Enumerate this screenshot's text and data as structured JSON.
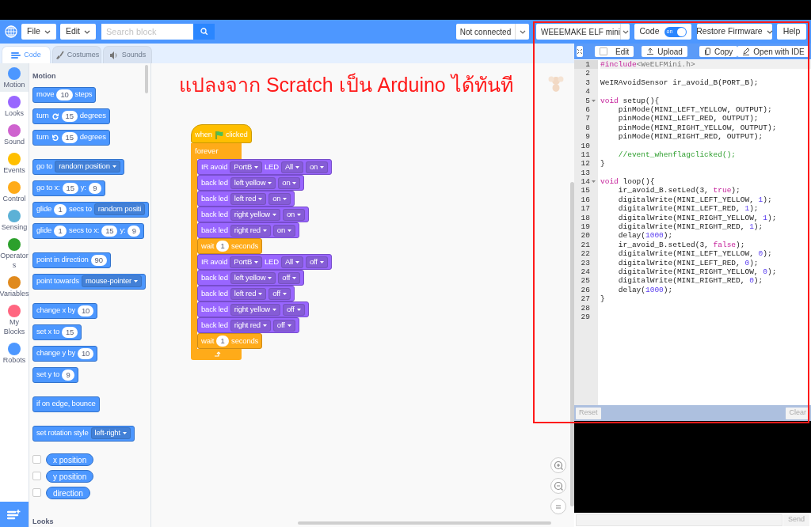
{
  "menu_bar": {
    "file": "File",
    "edit": "Edit",
    "search": {
      "placeholder": "Search block"
    },
    "connection": "Not connected",
    "device": "WEEEMAKE ELF mini",
    "code_toggle": {
      "label": "Code",
      "state_text": "on",
      "on": true
    },
    "restore": "Restore Firmware",
    "help": "Help"
  },
  "tabs": [
    {
      "label": "Code",
      "selected": true
    },
    {
      "label": "Costumes",
      "selected": false
    },
    {
      "label": "Sounds",
      "selected": false
    }
  ],
  "categories": [
    {
      "label": "Motion",
      "color": "#4c97ff",
      "selected": true
    },
    {
      "label": "Looks",
      "color": "#9966ff",
      "selected": false
    },
    {
      "label": "Sound",
      "color": "#cf63cf",
      "selected": false
    },
    {
      "label": "Events",
      "color": "#ffbf00",
      "selected": false
    },
    {
      "label": "Control",
      "color": "#ffab19",
      "selected": false
    },
    {
      "label": "Sensing",
      "color": "#5cb1d6",
      "selected": false
    },
    {
      "label": "Operators",
      "color": "#2ca02c",
      "selected": false
    },
    {
      "label": "Variables",
      "color": "#e08a1e",
      "selected": false
    },
    {
      "label": "My Blocks",
      "color": "#ff6680",
      "selected": false
    },
    {
      "label": "Robots",
      "color": "#4c97ff",
      "selected": false
    }
  ],
  "palette": {
    "heading": "Motion",
    "groups": [
      [
        {
          "kind": "motion",
          "parts": [
            {
              "kind": "text",
              "text": "move"
            },
            {
              "kind": "number",
              "text": "10"
            },
            {
              "kind": "text",
              "text": "steps"
            }
          ]
        },
        {
          "kind": "motion",
          "parts": [
            {
              "kind": "text",
              "text": "turn"
            },
            {
              "kind": "clockwise"
            },
            {
              "kind": "number",
              "text": "15"
            },
            {
              "kind": "text",
              "text": "degrees"
            }
          ]
        },
        {
          "kind": "motion",
          "parts": [
            {
              "kind": "text",
              "text": "turn"
            },
            {
              "kind": "counterclockwise"
            },
            {
              "kind": "number",
              "text": "15"
            },
            {
              "kind": "text",
              "text": "degrees"
            }
          ]
        }
      ],
      [
        {
          "kind": "motion",
          "parts": [
            {
              "kind": "text",
              "text": "go to"
            },
            {
              "kind": "dropdown",
              "text": "random position"
            }
          ]
        },
        {
          "kind": "motion",
          "parts": [
            {
              "kind": "text",
              "text": "go to x:"
            },
            {
              "kind": "number",
              "text": "15"
            },
            {
              "kind": "text",
              "text": "y:"
            },
            {
              "kind": "number",
              "text": "9"
            }
          ]
        },
        {
          "kind": "motion",
          "parts": [
            {
              "kind": "text",
              "text": "glide"
            },
            {
              "kind": "number",
              "text": "1"
            },
            {
              "kind": "text",
              "text": "secs to"
            },
            {
              "kind": "clipped",
              "text": "random positi"
            }
          ]
        },
        {
          "kind": "motion",
          "parts": [
            {
              "kind": "text",
              "text": "glide"
            },
            {
              "kind": "number",
              "text": "1"
            },
            {
              "kind": "text",
              "text": "secs to x:"
            },
            {
              "kind": "number",
              "text": "15"
            },
            {
              "kind": "text",
              "text": "y:"
            },
            {
              "kind": "number",
              "text": "9"
            }
          ]
        }
      ],
      [
        {
          "kind": "motion",
          "parts": [
            {
              "kind": "text",
              "text": "point in direction"
            },
            {
              "kind": "number",
              "text": "90"
            }
          ]
        },
        {
          "kind": "motion",
          "parts": [
            {
              "kind": "text",
              "text": "point towards"
            },
            {
              "kind": "dropdown",
              "text": "mouse-pointer"
            }
          ]
        }
      ],
      [
        {
          "kind": "motion",
          "parts": [
            {
              "kind": "text",
              "text": "change x by"
            },
            {
              "kind": "number",
              "text": "10"
            }
          ]
        },
        {
          "kind": "motion",
          "parts": [
            {
              "kind": "text",
              "text": "set x to"
            },
            {
              "kind": "number",
              "text": "15"
            }
          ]
        },
        {
          "kind": "motion",
          "parts": [
            {
              "kind": "text",
              "text": "change y by"
            },
            {
              "kind": "number",
              "text": "10"
            }
          ]
        },
        {
          "kind": "motion",
          "parts": [
            {
              "kind": "text",
              "text": "set y to"
            },
            {
              "kind": "number",
              "text": "9"
            }
          ]
        }
      ],
      [
        {
          "kind": "motion",
          "parts": [
            {
              "kind": "text",
              "text": "if on edge, bounce"
            }
          ]
        }
      ],
      [
        {
          "kind": "motion",
          "parts": [
            {
              "kind": "text",
              "text": "set rotation style"
            },
            {
              "kind": "dropdown",
              "text": "left-right"
            }
          ]
        }
      ]
    ],
    "reporters": [
      {
        "label": "x position",
        "checked": false
      },
      {
        "label": "y position",
        "checked": false
      },
      {
        "label": "direction",
        "checked": false
      }
    ],
    "next_heading": "Looks"
  },
  "script": {
    "title": "แปลงจาก Scratch เป็น Arduino ได้ทันที",
    "hat": {
      "kind": "events",
      "parts": [
        {
          "kind": "text",
          "text": "when"
        },
        {
          "kind": "flag"
        },
        {
          "kind": "text",
          "text": "clicked"
        }
      ]
    },
    "loop": {
      "label": "forever",
      "children": [
        {
          "kind": "robots",
          "parts": [
            {
              "kind": "text",
              "text": "IR avoid"
            },
            {
              "kind": "dropdown",
              "text": "PortB"
            },
            {
              "kind": "text",
              "text": "LED"
            },
            {
              "kind": "dropdown",
              "text": "All"
            },
            {
              "kind": "dropdown",
              "text": "on"
            }
          ]
        },
        {
          "kind": "robots",
          "parts": [
            {
              "kind": "text",
              "text": "back led"
            },
            {
              "kind": "dropdown",
              "text": "left yellow"
            },
            {
              "kind": "dropdown",
              "text": "on"
            }
          ]
        },
        {
          "kind": "robots",
          "parts": [
            {
              "kind": "text",
              "text": "back led"
            },
            {
              "kind": "dropdown",
              "text": "left red"
            },
            {
              "kind": "dropdown",
              "text": "on"
            }
          ]
        },
        {
          "kind": "robots",
          "parts": [
            {
              "kind": "text",
              "text": "back led"
            },
            {
              "kind": "dropdown",
              "text": "right yellow"
            },
            {
              "kind": "dropdown",
              "text": "on"
            }
          ]
        },
        {
          "kind": "robots",
          "parts": [
            {
              "kind": "text",
              "text": "back led"
            },
            {
              "kind": "dropdown",
              "text": "right red"
            },
            {
              "kind": "dropdown",
              "text": "on"
            }
          ]
        },
        {
          "kind": "control",
          "parts": [
            {
              "kind": "text",
              "text": "wait"
            },
            {
              "kind": "number",
              "text": "1"
            },
            {
              "kind": "text",
              "text": "seconds"
            }
          ]
        },
        {
          "kind": "robots",
          "parts": [
            {
              "kind": "text",
              "text": "IR avoid"
            },
            {
              "kind": "dropdown",
              "text": "PortB"
            },
            {
              "kind": "text",
              "text": "LED"
            },
            {
              "kind": "dropdown",
              "text": "All"
            },
            {
              "kind": "dropdown",
              "text": "off"
            }
          ]
        },
        {
          "kind": "robots",
          "parts": [
            {
              "kind": "text",
              "text": "back led"
            },
            {
              "kind": "dropdown",
              "text": "left yellow"
            },
            {
              "kind": "dropdown",
              "text": "off"
            }
          ]
        },
        {
          "kind": "robots",
          "parts": [
            {
              "kind": "text",
              "text": "back led"
            },
            {
              "kind": "dropdown",
              "text": "left red"
            },
            {
              "kind": "dropdown",
              "text": "off"
            }
          ]
        },
        {
          "kind": "robots",
          "parts": [
            {
              "kind": "text",
              "text": "back led"
            },
            {
              "kind": "dropdown",
              "text": "right yellow"
            },
            {
              "kind": "dropdown",
              "text": "off"
            }
          ]
        },
        {
          "kind": "robots",
          "parts": [
            {
              "kind": "text",
              "text": "back led"
            },
            {
              "kind": "dropdown",
              "text": "right red"
            },
            {
              "kind": "dropdown",
              "text": "off"
            }
          ]
        },
        {
          "kind": "control",
          "parts": [
            {
              "kind": "text",
              "text": "wait"
            },
            {
              "kind": "number",
              "text": "1"
            },
            {
              "kind": "text",
              "text": "seconds"
            }
          ]
        }
      ]
    }
  },
  "code_panel": {
    "highlight_frame": true,
    "toolbar": {
      "edit": {
        "label": "Edit",
        "checked": false
      },
      "upload": "Upload",
      "copy": "Copy",
      "open_ide": "Open with IDE"
    },
    "lines": [
      {
        "number": "1",
        "fold": false,
        "tokens": [
          {
            "kind": "include",
            "text": "#include"
          },
          {
            "kind": "header",
            "text": "<WeELFMini.h>"
          }
        ]
      },
      {
        "number": "2",
        "fold": false
      },
      {
        "number": "3",
        "fold": false,
        "tokens": [
          {
            "kind": "plain",
            "text": "WeIRAvoidSensor ir_avoid_B(PORT_B);"
          }
        ]
      },
      {
        "number": "4",
        "fold": false
      },
      {
        "number": "5",
        "fold": true,
        "tokens": [
          {
            "kind": "keyword",
            "text": "void"
          },
          {
            "kind": "plain",
            "text": " setup(){"
          }
        ]
      },
      {
        "number": "6",
        "fold": false,
        "tokens": [
          {
            "kind": "plain",
            "text": "    pinMode(MINI_LEFT_YELLOW, OUTPUT);"
          }
        ]
      },
      {
        "number": "7",
        "fold": false,
        "tokens": [
          {
            "kind": "plain",
            "text": "    pinMode(MINI_LEFT_RED, OUTPUT);"
          }
        ]
      },
      {
        "number": "8",
        "fold": false,
        "tokens": [
          {
            "kind": "plain",
            "text": "    pinMode(MINI_RIGHT_YELLOW, OUTPUT);"
          }
        ]
      },
      {
        "number": "9",
        "fold": false,
        "tokens": [
          {
            "kind": "plain",
            "text": "    pinMode(MINI_RIGHT_RED, OUTPUT);"
          }
        ]
      },
      {
        "number": "10",
        "fold": false
      },
      {
        "number": "11",
        "fold": false,
        "tokens": [
          {
            "kind": "comment",
            "text": "    //event_whenflagclicked();"
          }
        ]
      },
      {
        "number": "12",
        "fold": false,
        "tokens": [
          {
            "kind": "plain",
            "text": "}"
          }
        ]
      },
      {
        "number": "13",
        "fold": false
      },
      {
        "number": "14",
        "fold": true,
        "tokens": [
          {
            "kind": "keyword",
            "text": "void"
          },
          {
            "kind": "plain",
            "text": " loop(){"
          }
        ]
      },
      {
        "number": "15",
        "fold": false,
        "tokens": [
          {
            "kind": "plain",
            "text": "    ir_avoid_B.setLed(3, "
          },
          {
            "kind": "keyword",
            "text": "true"
          },
          {
            "kind": "plain",
            "text": ");"
          }
        ]
      },
      {
        "number": "16",
        "fold": false,
        "tokens": [
          {
            "kind": "plain",
            "text": "    digitalWrite(MINI_LEFT_YELLOW, "
          },
          {
            "kind": "number",
            "text": "1"
          },
          {
            "kind": "plain",
            "text": ");"
          }
        ]
      },
      {
        "number": "17",
        "fold": false,
        "tokens": [
          {
            "kind": "plain",
            "text": "    digitalWrite(MINI_LEFT_RED, "
          },
          {
            "kind": "number",
            "text": "1"
          },
          {
            "kind": "plain",
            "text": ");"
          }
        ]
      },
      {
        "number": "18",
        "fold": false,
        "tokens": [
          {
            "kind": "plain",
            "text": "    digitalWrite(MINI_RIGHT_YELLOW, "
          },
          {
            "kind": "number",
            "text": "1"
          },
          {
            "kind": "plain",
            "text": ");"
          }
        ]
      },
      {
        "number": "19",
        "fold": false,
        "tokens": [
          {
            "kind": "plain",
            "text": "    digitalWrite(MINI_RIGHT_RED, "
          },
          {
            "kind": "number",
            "text": "1"
          },
          {
            "kind": "plain",
            "text": ");"
          }
        ]
      },
      {
        "number": "20",
        "fold": false,
        "tokens": [
          {
            "kind": "plain",
            "text": "    delay("
          },
          {
            "kind": "number",
            "text": "1000"
          },
          {
            "kind": "plain",
            "text": ");"
          }
        ]
      },
      {
        "number": "21",
        "fold": false,
        "tokens": [
          {
            "kind": "plain",
            "text": "    ir_avoid_B.setLed(3, "
          },
          {
            "kind": "keyword",
            "text": "false"
          },
          {
            "kind": "plain",
            "text": ");"
          }
        ]
      },
      {
        "number": "22",
        "fold": false,
        "tokens": [
          {
            "kind": "plain",
            "text": "    digitalWrite(MINI_LEFT_YELLOW, "
          },
          {
            "kind": "number",
            "text": "0"
          },
          {
            "kind": "plain",
            "text": ");"
          }
        ]
      },
      {
        "number": "23",
        "fold": false,
        "tokens": [
          {
            "kind": "plain",
            "text": "    digitalWrite(MINI_LEFT_RED, "
          },
          {
            "kind": "number",
            "text": "0"
          },
          {
            "kind": "plain",
            "text": ");"
          }
        ]
      },
      {
        "number": "24",
        "fold": false,
        "tokens": [
          {
            "kind": "plain",
            "text": "    digitalWrite(MINI_RIGHT_YELLOW, "
          },
          {
            "kind": "number",
            "text": "0"
          },
          {
            "kind": "plain",
            "text": ");"
          }
        ]
      },
      {
        "number": "25",
        "fold": false,
        "tokens": [
          {
            "kind": "plain",
            "text": "    digitalWrite(MINI_RIGHT_RED, "
          },
          {
            "kind": "number",
            "text": "0"
          },
          {
            "kind": "plain",
            "text": ");"
          }
        ]
      },
      {
        "number": "26",
        "fold": false,
        "tokens": [
          {
            "kind": "plain",
            "text": "    delay("
          },
          {
            "kind": "number",
            "text": "1000"
          },
          {
            "kind": "plain",
            "text": ");"
          }
        ]
      },
      {
        "number": "27",
        "fold": false,
        "tokens": [
          {
            "kind": "plain",
            "text": "}"
          }
        ]
      },
      {
        "number": "28",
        "fold": false
      },
      {
        "number": "29",
        "fold": false
      }
    ],
    "reset": "Reset",
    "clear": "Clear",
    "send": "Send"
  }
}
